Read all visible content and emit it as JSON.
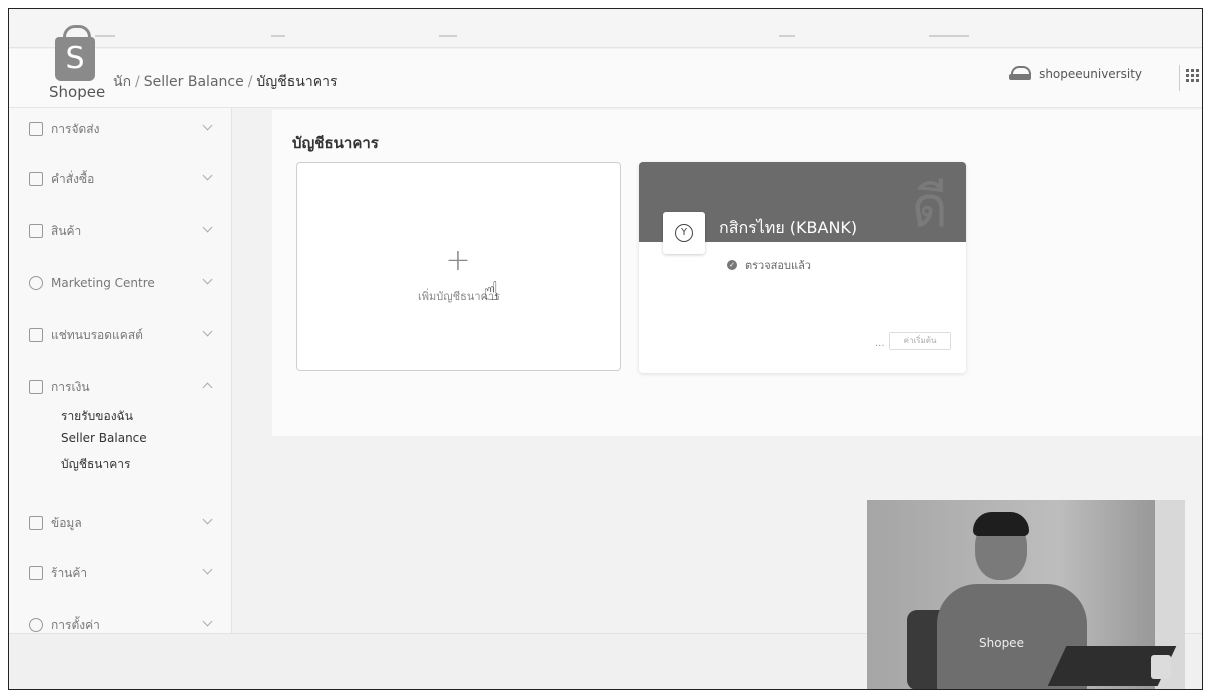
{
  "brand": {
    "logo_letter": "S",
    "name": "Shopee"
  },
  "breadcrumb": {
    "home": "นัก",
    "sep": "/",
    "level2": "Seller Balance",
    "current": "บัญชีธนาคาร"
  },
  "header": {
    "username": "shopeeuniversity"
  },
  "sidebar": {
    "items": [
      {
        "label": "การจัดส่ง",
        "icon": "truck-icon",
        "expanded": false
      },
      {
        "label": "คำสั่งซื้อ",
        "icon": "clipboard-icon",
        "expanded": false
      },
      {
        "label": "สินค้า",
        "icon": "box-icon",
        "expanded": false
      },
      {
        "label": "Marketing Centre",
        "icon": "tag-icon",
        "expanded": false
      },
      {
        "label": "แช่ทนบรอดแคสต์",
        "icon": "broadcast-icon",
        "expanded": false
      },
      {
        "label": "การเงิน",
        "icon": "wallet-icon",
        "expanded": true
      },
      {
        "label": "ข้อมูล",
        "icon": "chart-icon",
        "expanded": false
      },
      {
        "label": "ร้านค้า",
        "icon": "shop-icon",
        "expanded": false
      },
      {
        "label": "การตั้งค่า",
        "icon": "gear-icon",
        "expanded": false
      }
    ],
    "finance_sub": [
      "รายรับของฉัน",
      "Seller Balance",
      "บัญชีธนาคาร"
    ]
  },
  "main": {
    "title": "บัญชีธนาคาร",
    "add_card": {
      "plus": "+",
      "label": "เพิ่มบัญชีธนาคาร"
    },
    "bank_card": {
      "bank_name": "กสิกรไทย (KBANK)",
      "status": "ตรวจสอบแล้ว",
      "more": "...",
      "button": "ค่าเริ่มต้น"
    }
  },
  "video": {
    "shirt_text": "Shopee"
  }
}
